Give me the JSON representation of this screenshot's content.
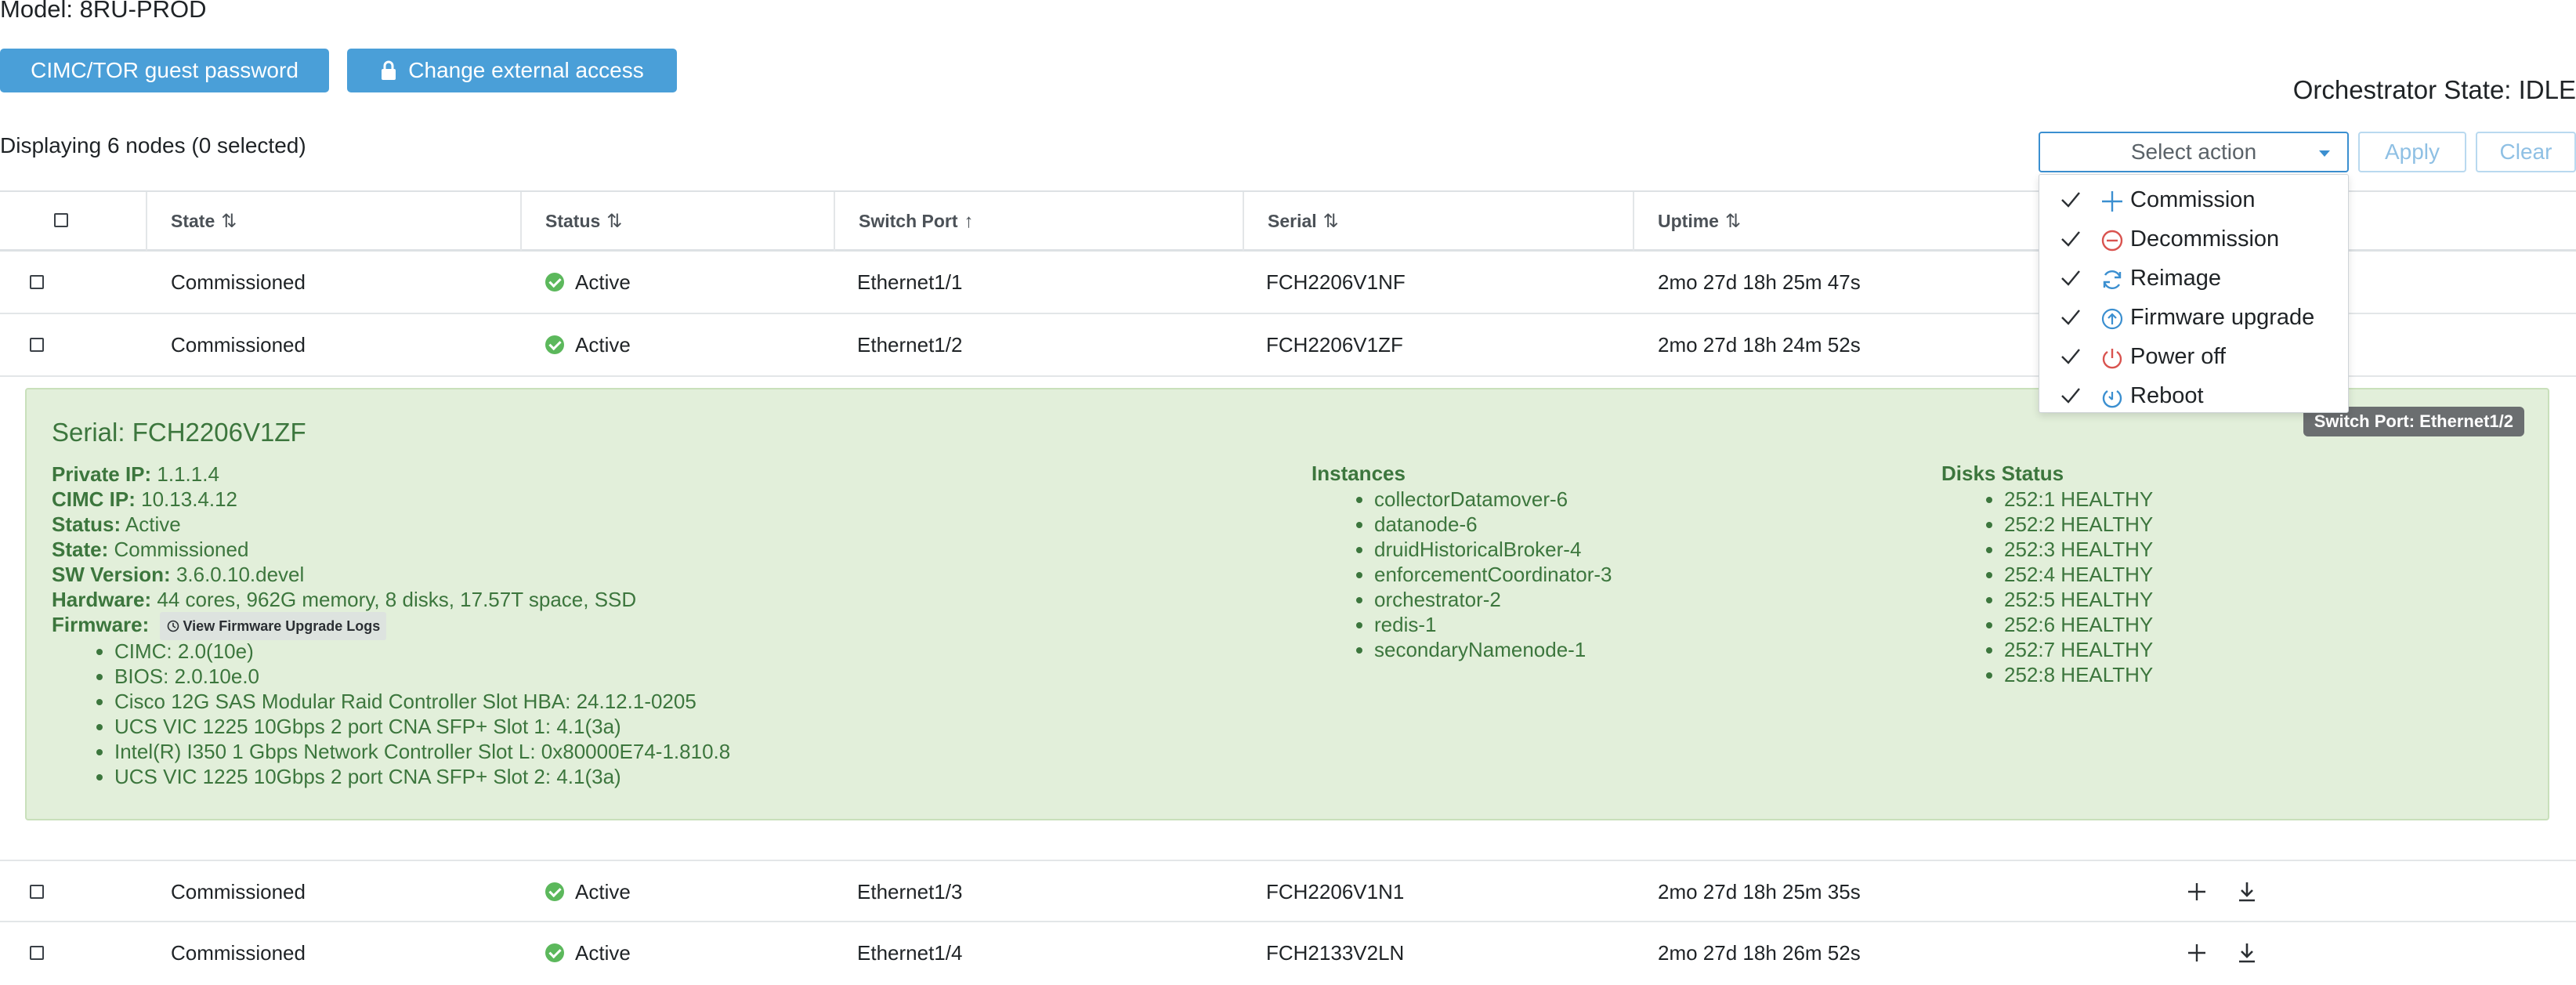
{
  "header": {
    "model": "Model: 8RU-PROD",
    "guest_password_button": "CIMC/TOR guest password",
    "external_access_button": "Change external access",
    "orchestrator_state": "Orchestrator State: IDLE",
    "displaying": "Displaying 6 nodes (0 selected)"
  },
  "actions": {
    "select_placeholder": "Select action",
    "apply": "Apply",
    "clear": "Clear",
    "menu": [
      {
        "label": "Commission",
        "icon": "plus-icon"
      },
      {
        "label": "Decommission",
        "icon": "minus-circle-icon"
      },
      {
        "label": "Reimage",
        "icon": "refresh-icon"
      },
      {
        "label": "Firmware upgrade",
        "icon": "upload-circle-icon"
      },
      {
        "label": "Power off",
        "icon": "power-icon"
      },
      {
        "label": "Reboot",
        "icon": "reboot-icon"
      }
    ]
  },
  "table": {
    "columns": {
      "state": "State",
      "status": "Status",
      "switch_port": "Switch Port",
      "serial": "Serial",
      "uptime": "Uptime"
    },
    "rows": [
      {
        "state": "Commissioned",
        "status": "Active",
        "switch_port": "Ethernet1/1",
        "serial": "FCH2206V1NF",
        "uptime": "2mo 27d 18h 25m 47s"
      },
      {
        "state": "Commissioned",
        "status": "Active",
        "switch_port": "Ethernet1/2",
        "serial": "FCH2206V1ZF",
        "uptime": "2mo 27d 18h 24m 52s"
      },
      {
        "state": "Commissioned",
        "status": "Active",
        "switch_port": "Ethernet1/3",
        "serial": "FCH2206V1N1",
        "uptime": "2mo 27d 18h 25m 35s"
      },
      {
        "state": "Commissioned",
        "status": "Active",
        "switch_port": "Ethernet1/4",
        "serial": "FCH2133V2LN",
        "uptime": "2mo 27d 18h 26m 52s"
      }
    ]
  },
  "detail": {
    "serial": "Serial: FCH2206V1ZF",
    "switch_port_badge": "Switch Port: Ethernet1/2",
    "private_ip_label": "Private IP:",
    "private_ip": "1.1.1.4",
    "cimc_ip_label": "CIMC IP:",
    "cimc_ip": "10.13.4.12",
    "status_label": "Status:",
    "status": "Active",
    "state_label": "State:",
    "state": "Commissioned",
    "sw_version_label": "SW Version:",
    "sw_version": "3.6.0.10.devel",
    "hardware_label": "Hardware:",
    "hardware": "44 cores, 962G memory, 8 disks, 17.57T space, SSD",
    "firmware_label": "Firmware:",
    "firmware_logs_button": "View Firmware Upgrade Logs",
    "firmware": [
      "CIMC: 2.0(10e)",
      "BIOS: 2.0.10e.0",
      "Cisco 12G SAS Modular Raid Controller Slot HBA: 24.12.1-0205",
      "UCS VIC 1225 10Gbps 2 port CNA SFP+ Slot 1: 4.1(3a)",
      "Intel(R) I350 1 Gbps Network Controller Slot L: 0x80000E74-1.810.8",
      "UCS VIC 1225 10Gbps 2 port CNA SFP+ Slot 2: 4.1(3a)"
    ],
    "instances_title": "Instances",
    "instances": [
      "collectorDatamover-6",
      "datanode-6",
      "druidHistoricalBroker-4",
      "enforcementCoordinator-3",
      "orchestrator-2",
      "redis-1",
      "secondaryNamenode-1"
    ],
    "disks_title": "Disks Status",
    "disks": [
      "252:1 HEALTHY",
      "252:2 HEALTHY",
      "252:3 HEALTHY",
      "252:4 HEALTHY",
      "252:5 HEALTHY",
      "252:6 HEALTHY",
      "252:7 HEALTHY",
      "252:8 HEALTHY"
    ]
  },
  "colors": {
    "primary": "#4a9fd8",
    "success": "#5cb85c",
    "detail_bg": "#e2efda",
    "detail_text": "#3c763d"
  }
}
